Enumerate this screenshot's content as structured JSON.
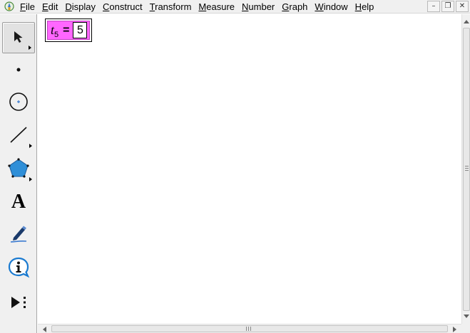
{
  "menubar": {
    "items": [
      {
        "mnemonic": "F",
        "rest": "ile"
      },
      {
        "mnemonic": "E",
        "rest": "dit"
      },
      {
        "mnemonic": "D",
        "rest": "isplay"
      },
      {
        "mnemonic": "C",
        "rest": "onstruct"
      },
      {
        "mnemonic": "T",
        "rest": "ransform"
      },
      {
        "mnemonic": "M",
        "rest": "easure"
      },
      {
        "mnemonic": "N",
        "rest": "umber"
      },
      {
        "mnemonic": "G",
        "rest": "raph"
      },
      {
        "mnemonic": "W",
        "rest": "indow"
      },
      {
        "mnemonic": "H",
        "rest": "elp"
      }
    ],
    "window_buttons": {
      "minimize": "–",
      "restore": "❐",
      "close": "✕"
    }
  },
  "toolbox": {
    "tools": [
      {
        "icon": "arrow-select-icon",
        "selected": true
      },
      {
        "icon": "point-icon",
        "selected": false
      },
      {
        "icon": "compass-icon",
        "selected": false
      },
      {
        "icon": "straightedge-icon",
        "selected": false
      },
      {
        "icon": "polygon-icon",
        "selected": false
      },
      {
        "icon": "text-icon",
        "label": "A",
        "selected": false
      },
      {
        "icon": "marker-icon",
        "selected": false
      },
      {
        "icon": "information-icon",
        "selected": false
      },
      {
        "icon": "custom-tool-icon",
        "selected": false
      }
    ]
  },
  "canvas": {
    "parameter": {
      "name": "t",
      "subscript": "5",
      "equals": "=",
      "value": "5",
      "fill_color": "#ff66ff"
    }
  }
}
